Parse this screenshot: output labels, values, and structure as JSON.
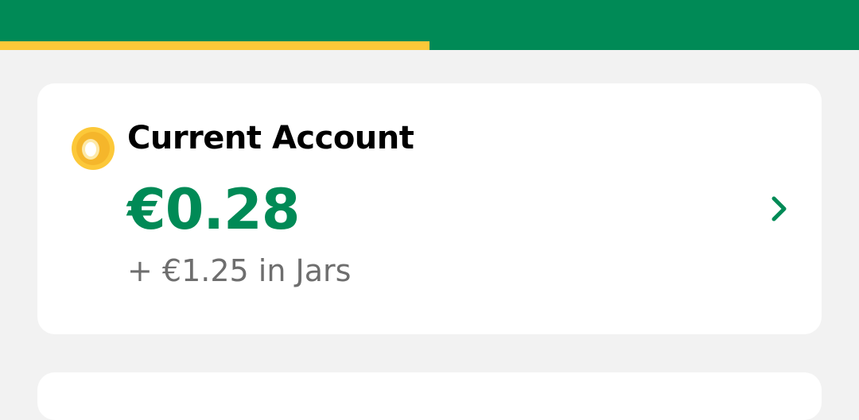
{
  "header": {
    "color": "#008a56",
    "progress": {
      "fraction": 0.5,
      "color": "#fcc839"
    }
  },
  "account": {
    "name": "Current Account",
    "balance": "€0.28",
    "jars_text": "+ €1.25 in Jars",
    "icon": "coin-icon",
    "chevron": "chevron-right-icon"
  },
  "colors": {
    "brand_green": "#008a56",
    "accent_yellow": "#fcc839",
    "background": "#f2f2f2",
    "card": "#ffffff",
    "secondary_text": "#6e6e6e"
  }
}
